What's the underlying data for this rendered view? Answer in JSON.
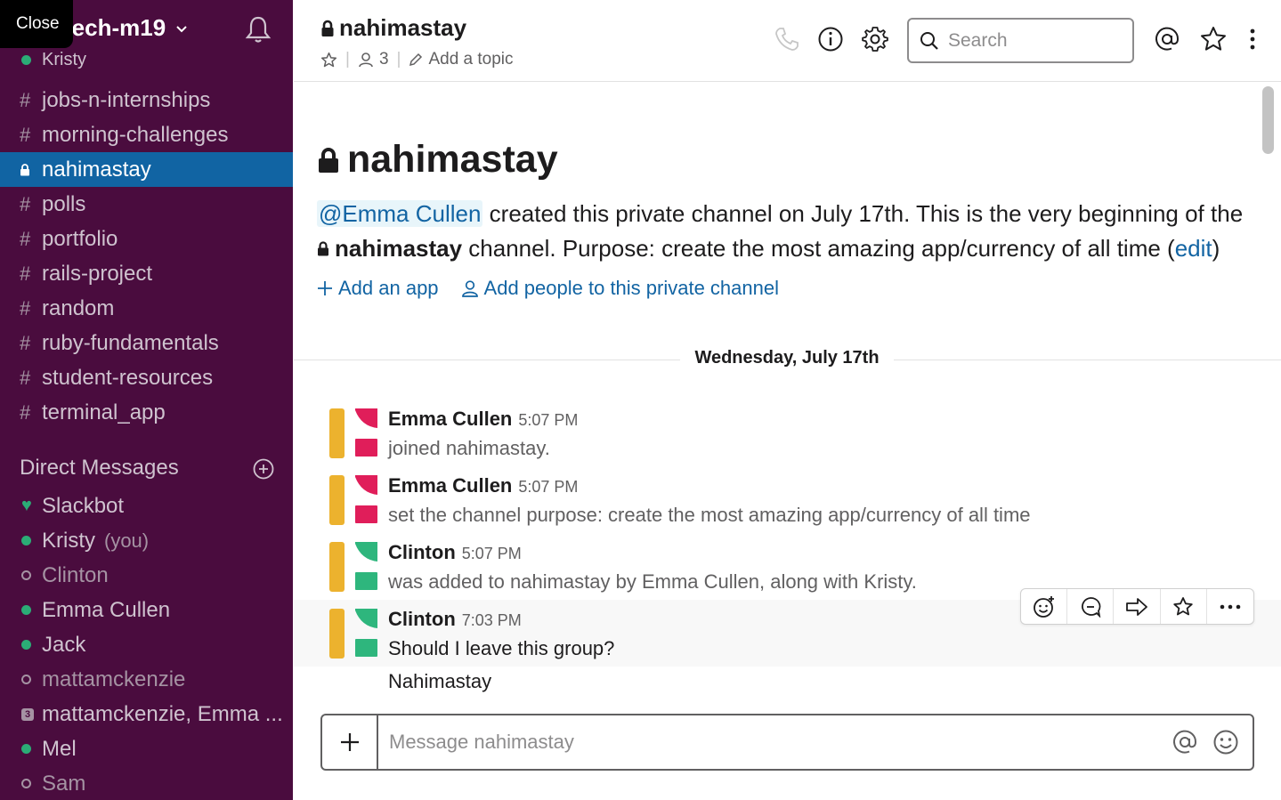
{
  "workspace": {
    "tooltip": "Close",
    "name": "tech-m19",
    "current_user": "Kristy"
  },
  "channels": [
    {
      "name": "jobs-n-internships",
      "private": false,
      "active": false
    },
    {
      "name": "morning-challenges",
      "private": false,
      "active": false
    },
    {
      "name": "nahimastay",
      "private": true,
      "active": true
    },
    {
      "name": "polls",
      "private": false,
      "active": false
    },
    {
      "name": "portfolio",
      "private": false,
      "active": false
    },
    {
      "name": "rails-project",
      "private": false,
      "active": false
    },
    {
      "name": "random",
      "private": false,
      "active": false
    },
    {
      "name": "ruby-fundamentals",
      "private": false,
      "active": false
    },
    {
      "name": "student-resources",
      "private": false,
      "active": false
    },
    {
      "name": "terminal_app",
      "private": false,
      "active": false
    }
  ],
  "direct_messages": {
    "heading": "Direct Messages",
    "items": [
      {
        "name": "Slackbot",
        "status": "bot"
      },
      {
        "name": "Kristy",
        "suffix": "(you)",
        "status": "online"
      },
      {
        "name": "Clinton",
        "status": "away"
      },
      {
        "name": "Emma Cullen",
        "status": "online"
      },
      {
        "name": "Jack",
        "status": "online"
      },
      {
        "name": "mattamckenzie",
        "status": "away"
      },
      {
        "name": "mattamckenzie, Emma ...",
        "status": "group",
        "count": "3"
      },
      {
        "name": "Mel",
        "status": "online"
      },
      {
        "name": "Sam",
        "status": "away"
      }
    ]
  },
  "header": {
    "channel": "nahimastay",
    "members": "3",
    "topic": "Add a topic",
    "search_placeholder": "Search"
  },
  "intro": {
    "title": "nahimastay",
    "mention": "@Emma Cullen",
    "text1": " created this private channel on July 17th. This is the very beginning of the ",
    "channel": "nahimastay",
    "text2": " channel. Purpose: create the most amazing app/currency of all time (",
    "edit": "edit",
    "text3": ")",
    "add_app": "Add an app",
    "add_people": "Add people to this private channel"
  },
  "date_divider": "Wednesday, July 17th",
  "messages": [
    {
      "author": "Emma Cullen",
      "time": "5:07 PM",
      "text": "joined nahimastay.",
      "system": true,
      "color": "#e01e5a"
    },
    {
      "author": "Emma Cullen",
      "time": "5:07 PM",
      "text": "set the channel purpose: create the most amazing app/currency of all time",
      "system": true,
      "color": "#e01e5a"
    },
    {
      "author": "Clinton",
      "time": "5:07 PM",
      "text": "was added to nahimastay by Emma Cullen, along with Kristy.",
      "system": true,
      "color": "#2eb67d"
    },
    {
      "author": "Clinton",
      "time": "7:03 PM",
      "text": "Should I leave this group?",
      "system": false,
      "color": "#2eb67d"
    }
  ],
  "extra_message": "Nahimastay",
  "composer": {
    "placeholder": "Message nahimastay"
  },
  "colors": {
    "sidebar_bg": "#4a0c3e",
    "active_channel": "#1164a3",
    "online": "#2bac76",
    "avatar_gold": "#ecb22e",
    "link": "#1264a3"
  }
}
